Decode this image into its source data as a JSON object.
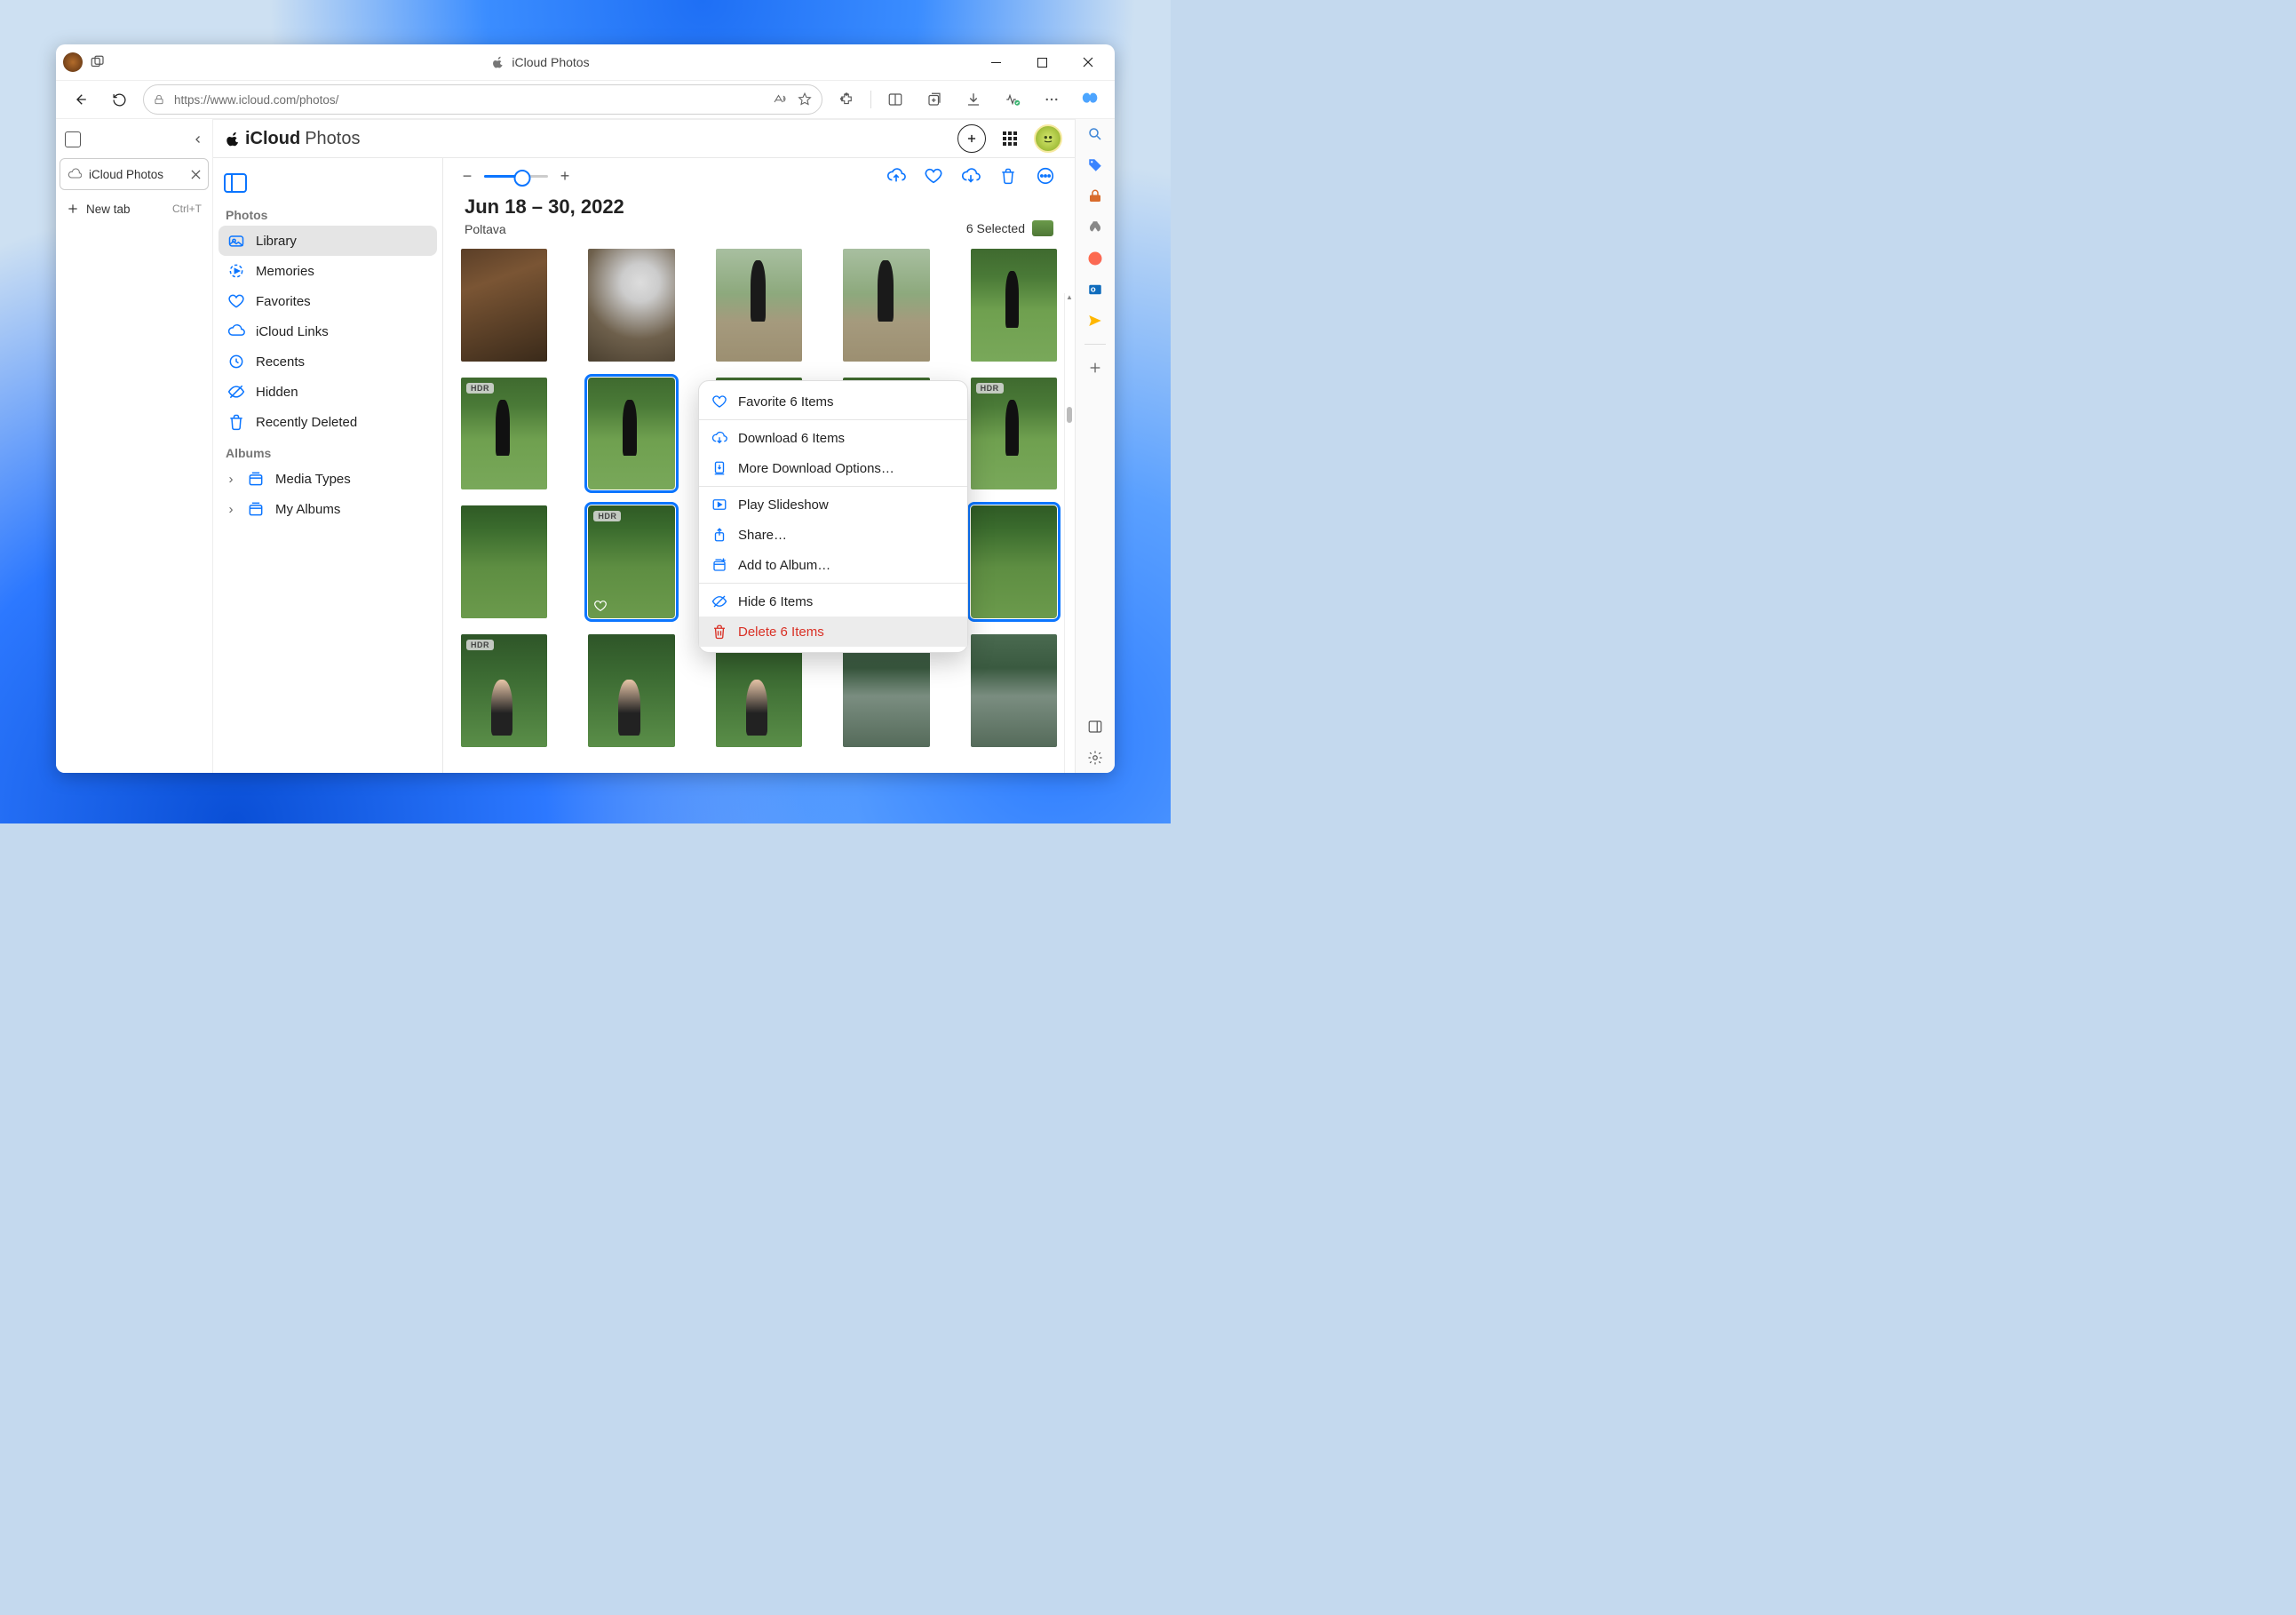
{
  "titlebar": {
    "title": "iCloud Photos"
  },
  "toolbar": {
    "url": "https://www.icloud.com/photos/"
  },
  "vtabs": {
    "tab_label": "iCloud Photos",
    "new_tab": "New tab",
    "shortcut": "Ctrl+T"
  },
  "icloud": {
    "brand_icloud": "iCloud",
    "brand_photos": "Photos",
    "sidebar": {
      "section_photos": "Photos",
      "section_albums": "Albums",
      "items": {
        "library": "Library",
        "memories": "Memories",
        "favorites": "Favorites",
        "icloud_links": "iCloud Links",
        "recents": "Recents",
        "hidden": "Hidden",
        "recently_deleted": "Recently Deleted",
        "media_types": "Media Types",
        "my_albums": "My Albums"
      }
    },
    "date_range": "Jun 18 – 30, 2022",
    "location": "Poltava",
    "selection_label": "6 Selected",
    "hdr_badge": "HDR",
    "photos": [
      {
        "style": "indoor",
        "hdr": false,
        "sel": false,
        "fav": false
      },
      {
        "style": "cat",
        "hdr": false,
        "sel": false,
        "fav": false
      },
      {
        "style": "path",
        "hdr": false,
        "sel": false,
        "fav": false
      },
      {
        "style": "path",
        "hdr": false,
        "sel": false,
        "fav": false
      },
      {
        "style": "park",
        "hdr": false,
        "sel": false,
        "fav": false
      },
      {
        "style": "park",
        "hdr": true,
        "sel": false,
        "fav": false
      },
      {
        "style": "park",
        "hdr": false,
        "sel": true,
        "fav": false
      },
      {
        "style": "park",
        "hdr": false,
        "sel": false,
        "fav": false
      },
      {
        "style": "park",
        "hdr": false,
        "sel": false,
        "fav": false
      },
      {
        "style": "park",
        "hdr": true,
        "sel": false,
        "fav": false
      },
      {
        "style": "grass",
        "hdr": false,
        "sel": false,
        "fav": false
      },
      {
        "style": "grass",
        "hdr": true,
        "sel": true,
        "fav": true
      },
      {
        "style": "grass",
        "hdr": false,
        "sel": true,
        "fav": false
      },
      {
        "style": "grass",
        "hdr": false,
        "sel": true,
        "fav": false
      },
      {
        "style": "grass",
        "hdr": false,
        "sel": true,
        "fav": false
      },
      {
        "style": "forest",
        "hdr": true,
        "sel": false,
        "fav": false
      },
      {
        "style": "forest",
        "hdr": false,
        "sel": false,
        "fav": false
      },
      {
        "style": "forest",
        "hdr": false,
        "sel": false,
        "fav": false
      },
      {
        "style": "lake",
        "hdr": false,
        "sel": false,
        "fav": false
      },
      {
        "style": "lake",
        "hdr": false,
        "sel": false,
        "fav": false
      }
    ]
  },
  "context_menu": {
    "favorite": "Favorite 6 Items",
    "download": "Download 6 Items",
    "more_dl": "More Download Options…",
    "slideshow": "Play Slideshow",
    "share": "Share…",
    "add_album": "Add to Album…",
    "hide": "Hide 6 Items",
    "delete": "Delete 6 Items"
  }
}
